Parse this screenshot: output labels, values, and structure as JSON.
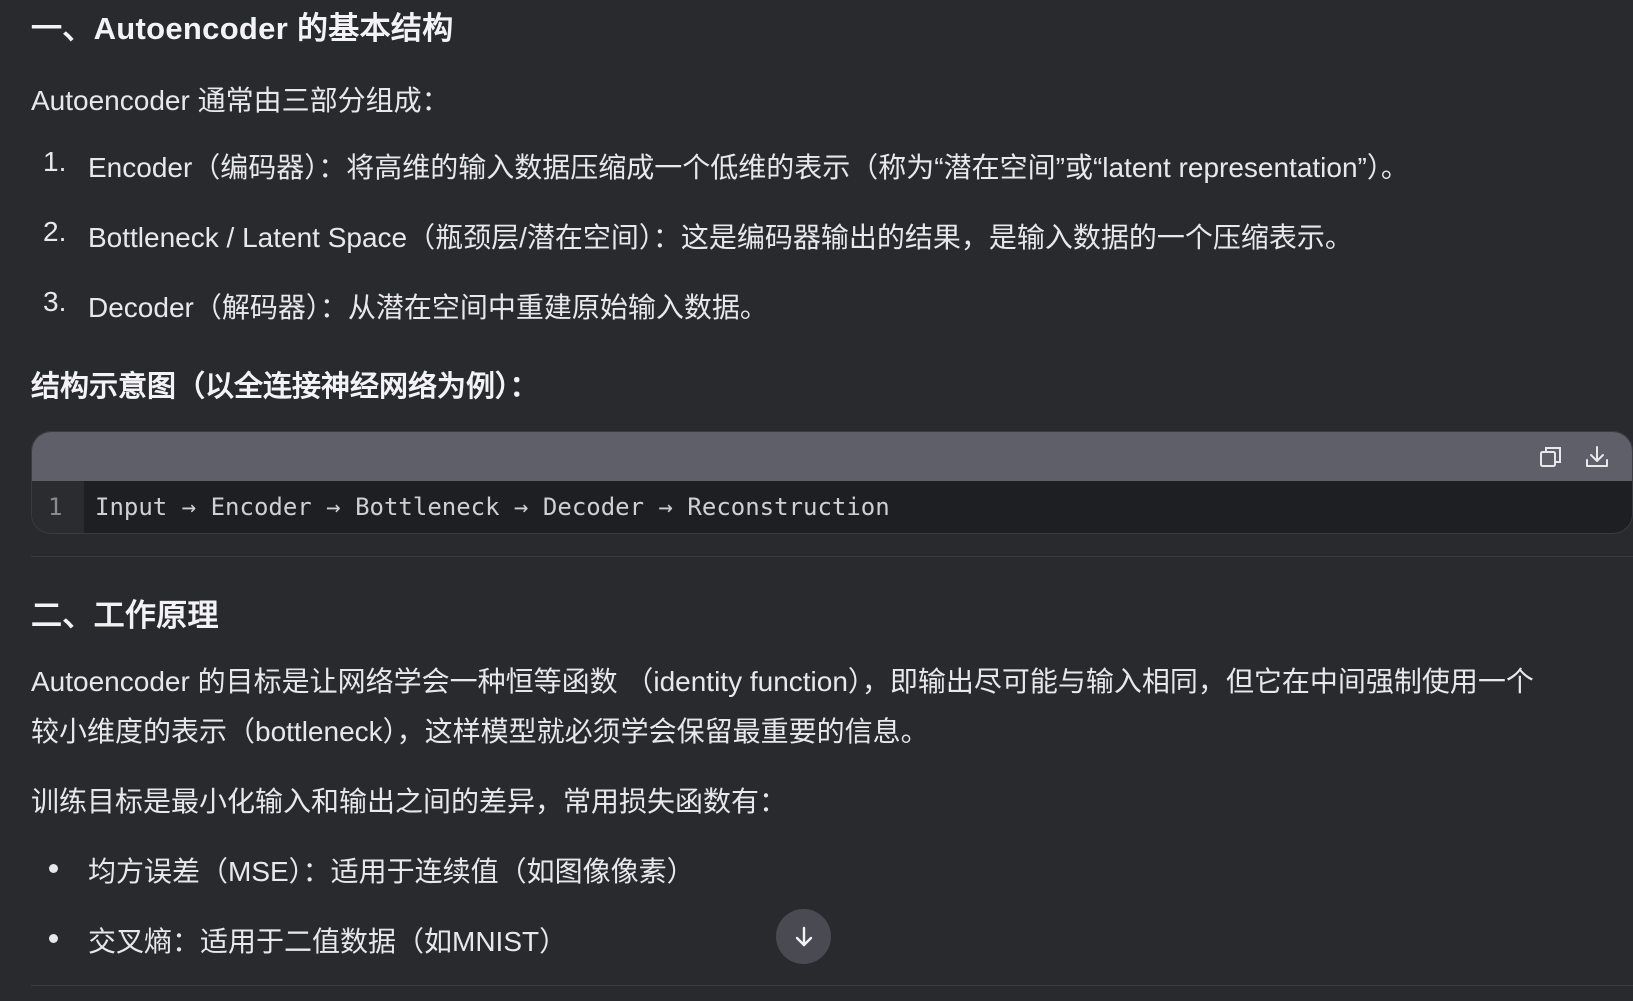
{
  "sections": {
    "s1_heading": "一、Autoencoder 的基本结构",
    "s1_intro": "Autoencoder 通常由三部分组成：",
    "s1_list": [
      {
        "marker": "1.",
        "text": "Encoder（编码器）：将高维的输入数据压缩成一个低维的表示（称为“潜在空间”或“latent representation”）。"
      },
      {
        "marker": "2.",
        "text": "Bottleneck / Latent Space（瓶颈层/潜在空间）：这是编码器输出的结果，是输入数据的一个压缩表示。"
      },
      {
        "marker": "3.",
        "text": "Decoder（解码器）：从潜在空间中重建原始输入数据。"
      }
    ],
    "diagram_heading": "结构示意图（以全连接神经网络为例）：",
    "code": {
      "line_number": "1",
      "line": "Input → Encoder → Bottleneck → Decoder → Reconstruction",
      "copy_icon": "copy-icon",
      "download_icon": "download-icon"
    },
    "s2_heading": "二、工作原理",
    "s2_para_line1": "Autoencoder 的目标是让网络学会一种恒等函数 （identity function），即输出尽可能与输入相同，但它在中间强制使用一个",
    "s2_para_line2": "较小维度的表示（bottleneck），这样模型就必须学会保留最重要的信息。",
    "s2_training": "训练目标是最小化输入和输出之间的差异，常用损失函数有：",
    "s2_list": [
      {
        "text": "均方误差（MSE）：适用于连续值（如图像像素）"
      },
      {
        "text": "交叉熵：适用于二值数据（如MNIST）"
      }
    ],
    "scroll_icon": "arrow-down-icon"
  }
}
